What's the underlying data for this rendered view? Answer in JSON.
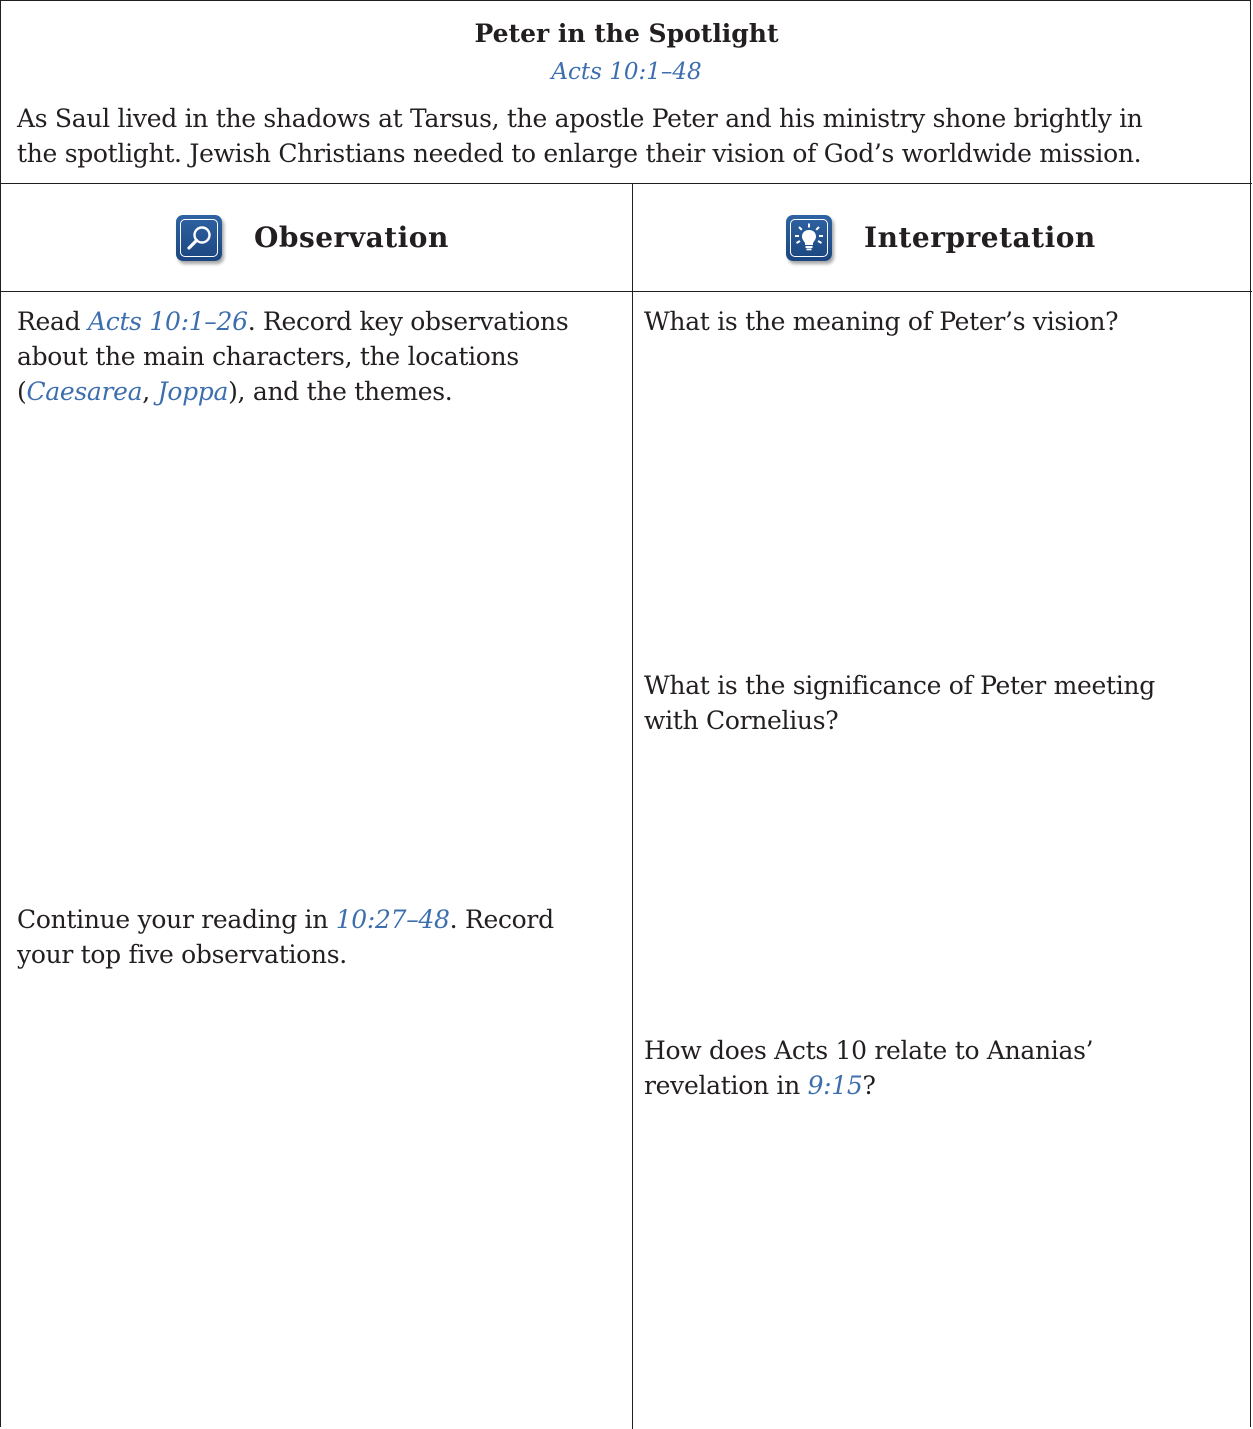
{
  "header": {
    "title": "Peter in the Spotlight",
    "subtitle_ref": "Acts 10:1–48",
    "intro_line1": "As Saul lived in the shadows at Tarsus, the apostle Peter and his ministry shone brightly in",
    "intro_line2": "the spotlight. Jewish Christians needed to enlarge their vision of God’s worldwide mission."
  },
  "columns": {
    "observation": {
      "label": "Observation",
      "icon": "magnifying-glass-icon"
    },
    "interpretation": {
      "label": "Interpretation",
      "icon": "lightbulb-icon"
    }
  },
  "observation_prompts": [
    {
      "l1_a": "Read ",
      "l1_ref": "Acts 10:1–26",
      "l1_b": ". Record key observations",
      "l2": "about the main characters, the locations",
      "l3_a": "(",
      "l3_ref1": "Caesarea",
      "l3_b": ", ",
      "l3_ref2": "Joppa",
      "l3_c": "), and the themes."
    },
    {
      "l1_a": "Continue your reading in ",
      "l1_ref": "10:27–48",
      "l1_b": ". Record",
      "l2": "your top five observations."
    }
  ],
  "interpretation_prompts": [
    {
      "l1": "What is the meaning of Peter’s vision?"
    },
    {
      "l1": "What is the significance of Peter meeting",
      "l2": "with Cornelius?"
    },
    {
      "l1": "How does Acts 10 relate to Ananias’",
      "l2_a": "revelation in ",
      "l2_ref": "9:15",
      "l2_b": "?"
    }
  ],
  "colors": {
    "reference_link": "#3d6fae",
    "icon_blue": "#1f4f8e",
    "rule": "#231f20"
  }
}
